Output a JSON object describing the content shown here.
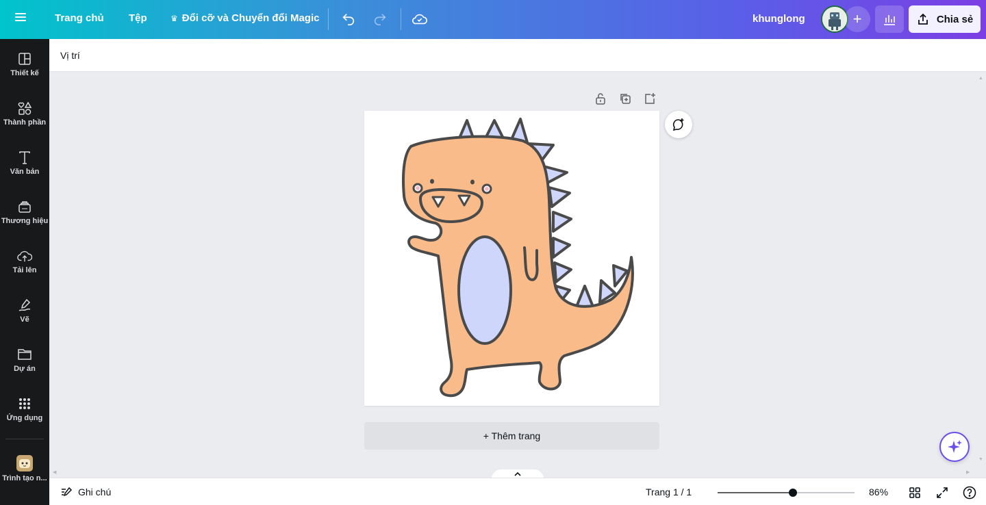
{
  "topbar": {
    "home": "Trang chủ",
    "file": "Tệp",
    "magic_crown": "♛",
    "magic_resize": "Đổi cỡ và Chuyển đổi Magic",
    "project_name": "khunglong",
    "share": "Chia sẻ",
    "add_icon": "+"
  },
  "sidebar": {
    "items": [
      {
        "label": "Thiết kế",
        "icon": "layout-icon"
      },
      {
        "label": "Thành phần",
        "icon": "shapes-icon"
      },
      {
        "label": "Văn bản",
        "icon": "text-icon"
      },
      {
        "label": "Thương hiệu",
        "icon": "brand-icon"
      },
      {
        "label": "Tải lên",
        "icon": "upload-cloud-icon"
      },
      {
        "label": "Vẽ",
        "icon": "draw-icon"
      },
      {
        "label": "Dự án",
        "icon": "folder-icon"
      },
      {
        "label": "Ứng dụng",
        "icon": "apps-grid-icon"
      },
      {
        "label": "Trình tạo n...",
        "icon": "app-avatar-icon"
      }
    ]
  },
  "context_bar": {
    "position": "Vị trí"
  },
  "canvas": {
    "add_page": "+ Thêm trang",
    "page_bg": "#ffffff",
    "dino_body_color": "#f9bb8a",
    "dino_belly_color": "#cfd6fb",
    "outline_color": "#4a4a4a"
  },
  "bottombar": {
    "notes": "Ghi chú",
    "page_count": "Trang 1 / 1",
    "zoom_label": "86%",
    "zoom_fraction": 0.55
  },
  "colors": {
    "sidebar_bg": "#18191b",
    "canvas_bg": "#ebecf0",
    "accent_start": "#00c4cc",
    "accent_end": "#7b3fe4"
  }
}
